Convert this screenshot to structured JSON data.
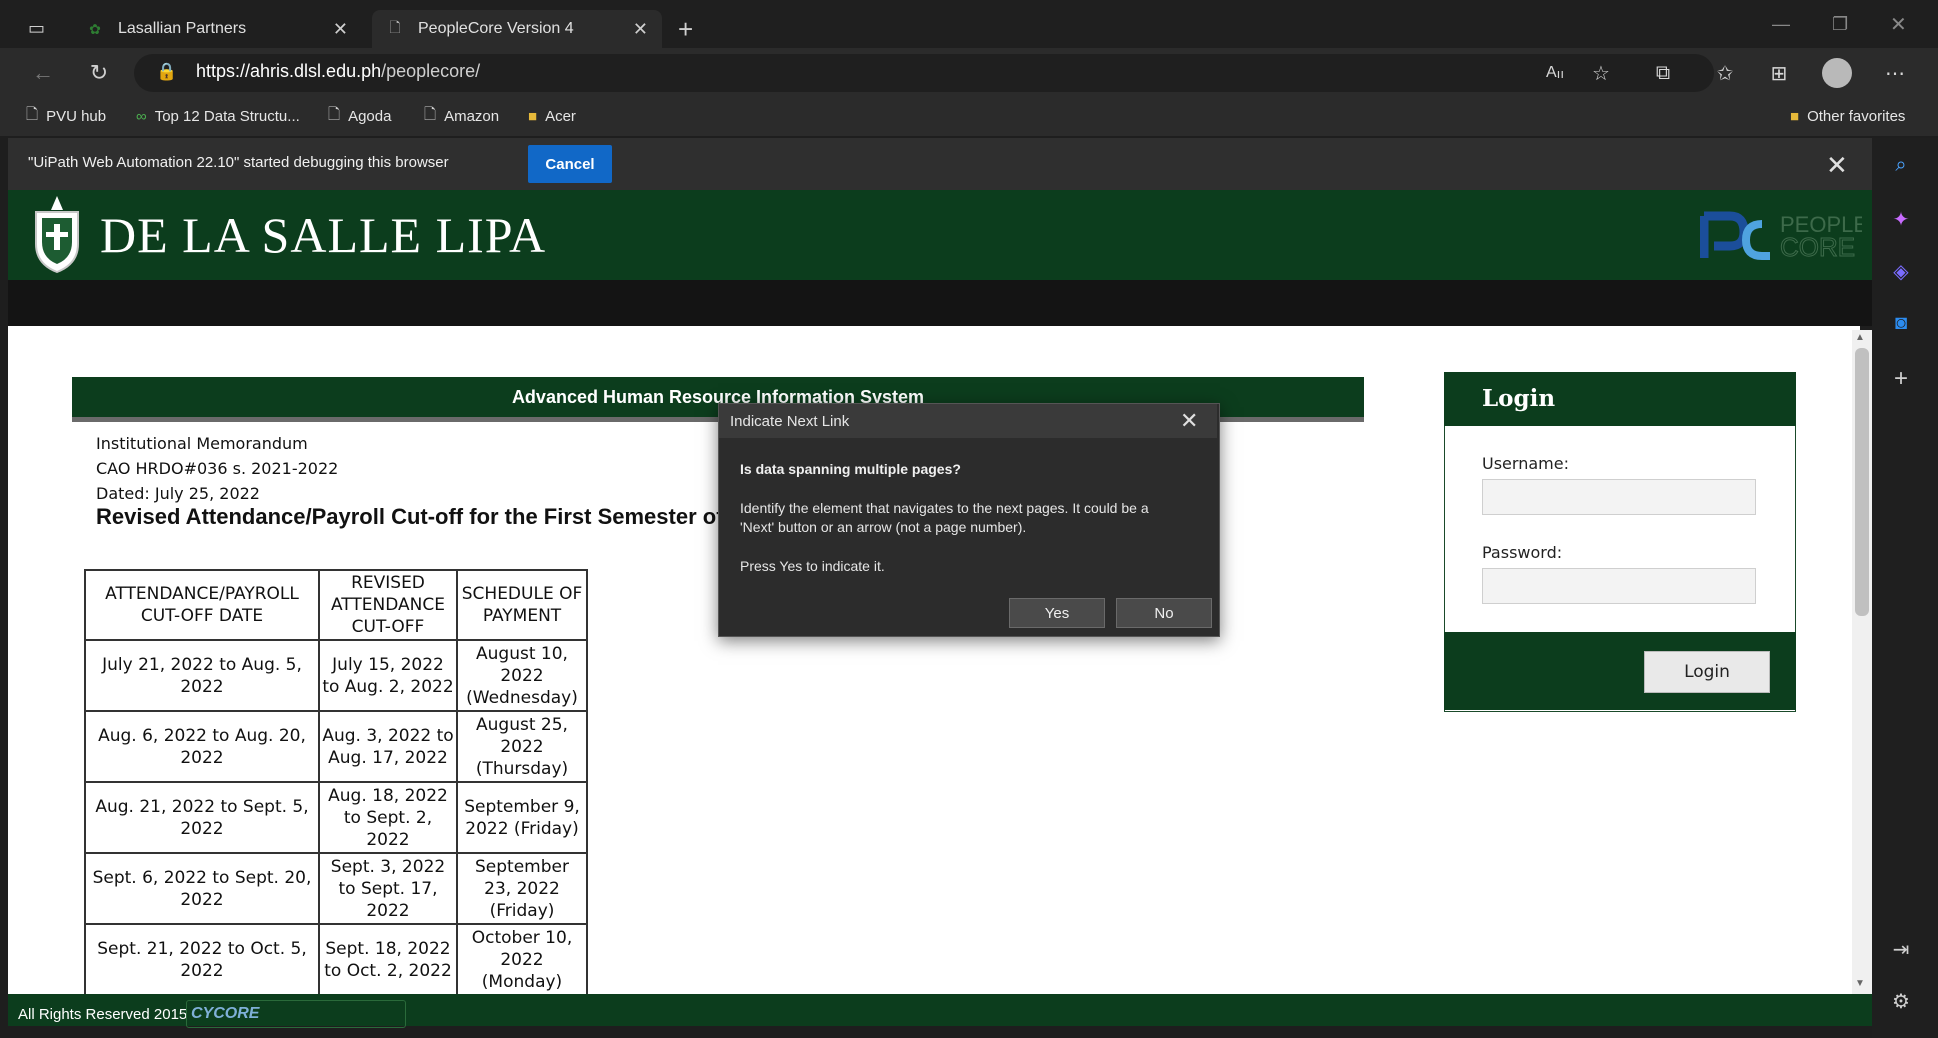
{
  "browser": {
    "tabs": [
      {
        "label": "Lasallian Partners"
      },
      {
        "label": "PeopleCore Version 4"
      }
    ],
    "new_tab": "+",
    "url_host": "https://ahris.dlsl.edu.ph",
    "url_path": "/peoplecore/",
    "favorites": [
      {
        "label": "PVU hub",
        "icon": "page-icon"
      },
      {
        "label": "Top 12 Data Structu...",
        "icon": "link-icon"
      },
      {
        "label": "Agoda",
        "icon": "page-icon"
      },
      {
        "label": "Amazon",
        "icon": "page-icon"
      },
      {
        "label": "Acer",
        "icon": "folder-icon"
      }
    ],
    "other_favorites": "Other favorites"
  },
  "debug_bar": {
    "message": "\"UiPath Web Automation 22.10\" started debugging this browser",
    "cancel": "Cancel"
  },
  "site": {
    "title": "DE LA SALLE LIPA",
    "peoplecore_logo": "PEOPLE CORE",
    "system_title": "Advanced Human Resource Information System",
    "memo": {
      "line1": "Institutional Memorandum",
      "line2": "CAO HRDO#036 s. 2021-2022",
      "line3": "Dated: July 25, 2022",
      "title": "Revised Attendance/Payroll Cut-off for the First Semester of"
    },
    "table": {
      "headers": [
        "ATTENDANCE/PAYROLL CUT-OFF DATE",
        "REVISED ATTENDANCE CUT-OFF",
        "SCHEDULE OF PAYMENT"
      ],
      "rows": [
        [
          "July 21, 2022 to Aug. 5, 2022",
          "July 15, 2022 to Aug. 2, 2022",
          "August 10, 2022 (Wednesday)"
        ],
        [
          "Aug. 6, 2022 to Aug. 20, 2022",
          "Aug. 3, 2022 to Aug. 17, 2022",
          "August 25, 2022 (Thursday)"
        ],
        [
          "Aug. 21, 2022 to Sept. 5, 2022",
          "Aug. 18, 2022 to Sept. 2, 2022",
          "September 9, 2022 (Friday)"
        ],
        [
          "Sept. 6, 2022 to Sept. 20, 2022",
          "Sept. 3, 2022 to Sept. 17, 2022",
          "September 23, 2022 (Friday)"
        ],
        [
          "Sept. 21, 2022 to Oct. 5, 2022",
          "Sept. 18, 2022 to Oct. 2, 2022",
          "October 10, 2022 (Monday)"
        ]
      ]
    },
    "login": {
      "title": "Login",
      "username_label": "Username:",
      "password_label": "Password:",
      "button": "Login"
    },
    "footer": {
      "text": "All Rights Reserved 2015",
      "logo": "CYCORE"
    }
  },
  "dialog": {
    "title": "Indicate Next Link",
    "question": "Is data spanning multiple pages?",
    "body": "Identify the element that navigates to the next pages. It could be a 'Next' button or an arrow (not a page number).",
    "instruction": "Press Yes to indicate it.",
    "yes": "Yes",
    "no": "No"
  },
  "colors": {
    "brand_green": "#0c3d1d",
    "cancel_blue": "#1168c7"
  }
}
